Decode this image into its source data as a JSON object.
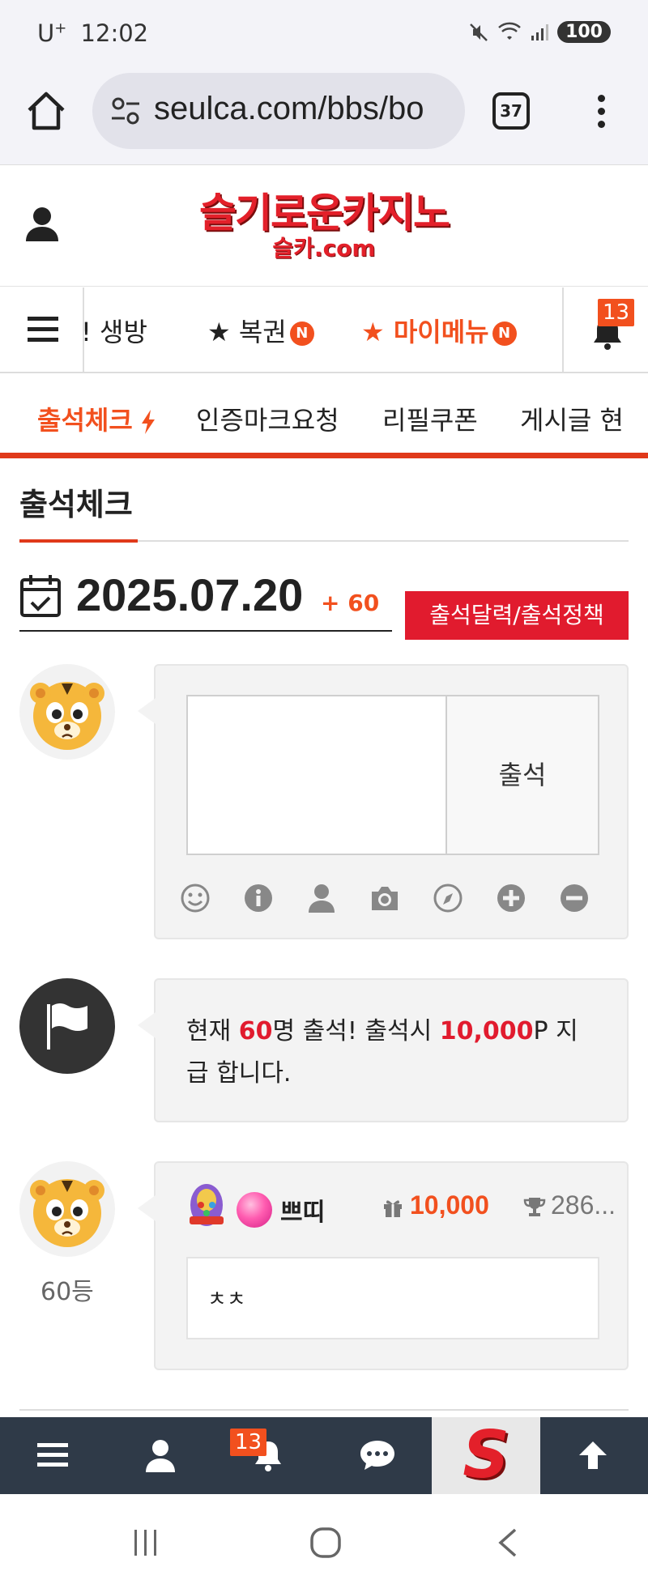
{
  "status_bar": {
    "carrier": "U",
    "carrier_sup": "+",
    "time": "12:02",
    "battery": "100"
  },
  "browser": {
    "url": "seulca.com/bbs/bo",
    "tab_count": "37"
  },
  "header": {
    "logo_main": "슬기로운카지노",
    "logo_sub": "슬카.com"
  },
  "nav_main": {
    "items": [
      {
        "label": "! 생방"
      },
      {
        "label": "★ 복권",
        "badge": "N"
      },
      {
        "label": "★ 마이메뉴",
        "badge": "N"
      }
    ],
    "notification_count": "13"
  },
  "nav_sub": {
    "items": [
      {
        "label": "출석체크"
      },
      {
        "label": "인증마크요청"
      },
      {
        "label": "리필쿠폰"
      },
      {
        "label": "게시글 현"
      }
    ]
  },
  "page": {
    "title": "출석체크",
    "date": "2025.07.20",
    "date_plus": "+ 60",
    "calendar_button": "출석달력/출석정책"
  },
  "attendance_form": {
    "submit_label": "출석"
  },
  "notice": {
    "pre": "현재 ",
    "count": "60",
    "mid": "명 출석! 출석시 ",
    "points": "10,000",
    "post": "P 지급 합니다."
  },
  "comment": {
    "rank": "60등",
    "nickname": "쁘띠",
    "points": "10,000",
    "score": "286...",
    "text": "ㅊㅊ"
  },
  "bottom_bar": {
    "notification_count": "13"
  },
  "colors": {
    "accent": "#f2501e",
    "red": "#e11b2e",
    "bottom_bar": "#2f3a48"
  }
}
